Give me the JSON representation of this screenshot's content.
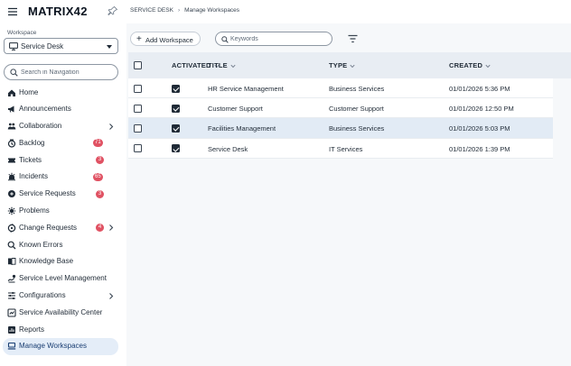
{
  "app": {
    "logo_text": "MATRIX42"
  },
  "breadcrumb": {
    "root": "SERVICE DESK",
    "current": "Manage Workspaces"
  },
  "workspace": {
    "label": "Workspace",
    "selected": "Service Desk"
  },
  "nav_search": {
    "placeholder": "Search in Navigation"
  },
  "nav": {
    "items": [
      {
        "label": "Home",
        "icon": "home-icon"
      },
      {
        "label": "Announcements",
        "icon": "megaphone-icon"
      },
      {
        "label": "Collaboration",
        "icon": "collaboration-icon",
        "expandable": true
      },
      {
        "label": "Backlog",
        "icon": "backlog-icon",
        "badge": "71"
      },
      {
        "label": "Tickets",
        "icon": "ticket-icon",
        "badge": "3"
      },
      {
        "label": "Incidents",
        "icon": "incident-icon",
        "badge": "65"
      },
      {
        "label": "Service Requests",
        "icon": "service-request-icon",
        "badge": "3"
      },
      {
        "label": "Problems",
        "icon": "problem-icon"
      },
      {
        "label": "Change Requests",
        "icon": "change-request-icon",
        "badge": "4",
        "expandable": true
      },
      {
        "label": "Known Errors",
        "icon": "known-errors-icon"
      },
      {
        "label": "Knowledge Base",
        "icon": "book-icon"
      },
      {
        "label": "Service Level Management",
        "icon": "sla-icon"
      },
      {
        "label": "Configurations",
        "icon": "sliders-icon",
        "expandable": true
      },
      {
        "label": "Service Availability Center",
        "icon": "availability-icon"
      },
      {
        "label": "Reports",
        "icon": "report-icon"
      },
      {
        "label": "Manage Workspaces",
        "icon": "workspace-icon",
        "active": true
      }
    ]
  },
  "toolbar": {
    "add_label": "Add Workspace",
    "search_placeholder": "Keywords"
  },
  "table": {
    "headers": {
      "activated": "ACTIVATED",
      "title": "TITLE",
      "type": "TYPE",
      "created": "CREATED"
    },
    "rows": [
      {
        "title": "HR Service Management",
        "type": "Business Services",
        "created": "01/01/2026 5:36 PM",
        "activated": true,
        "highlight": false
      },
      {
        "title": "Customer Support",
        "type": "Customer Support",
        "created": "01/01/2026 12:50 PM",
        "activated": true,
        "highlight": false
      },
      {
        "title": "Facilities Management",
        "type": "Business Services",
        "created": "01/01/2026 5:03 PM",
        "activated": true,
        "highlight": true
      },
      {
        "title": "Service Desk",
        "type": "IT Services",
        "created": "01/01/2026 1:39 PM",
        "activated": true,
        "highlight": false
      }
    ]
  },
  "colors": {
    "badge": "#e05263",
    "active_nav": "#e4edf8",
    "highlight_row": "#e2ebf5",
    "header_bg": "#e8edf3"
  }
}
